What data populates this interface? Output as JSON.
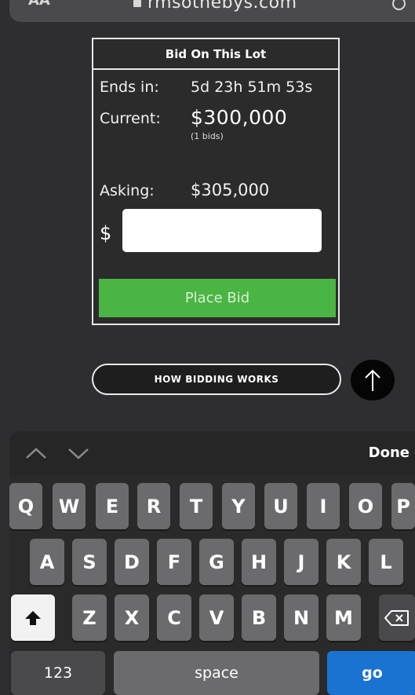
{
  "browser": {
    "text_size_label": "AA",
    "url": "rmsothebys.com"
  },
  "bid_box": {
    "title": "Bid On This Lot",
    "ends_label": "Ends in:",
    "ends_value": "5d 23h 51m 53s",
    "current_label": "Current:",
    "current_value": "$300,000",
    "bids_count": "(1 bids)",
    "asking_label": "Asking:",
    "asking_value": "$305,000",
    "currency_symbol": "$",
    "bid_input_value": "",
    "place_bid_label": "Place Bid",
    "place_bid_color": "#4bb543"
  },
  "how_bidding_works_label": "HOW BIDDING WORKS",
  "scroll_top_icon": "arrow-up-icon",
  "accessory_bar": {
    "prev_icon": "chevron-up-icon",
    "next_icon": "chevron-down-icon",
    "done_label": "Done"
  },
  "keyboard": {
    "row1": [
      "Q",
      "W",
      "E",
      "R",
      "T",
      "Y",
      "U",
      "I",
      "O",
      "P"
    ],
    "row2": [
      "A",
      "S",
      "D",
      "F",
      "G",
      "H",
      "J",
      "K",
      "L"
    ],
    "row3": [
      "Z",
      "X",
      "C",
      "V",
      "B",
      "N",
      "M"
    ],
    "numbers_label": "123",
    "space_label": "space",
    "go_label": "go",
    "go_color": "#1a73d1"
  }
}
